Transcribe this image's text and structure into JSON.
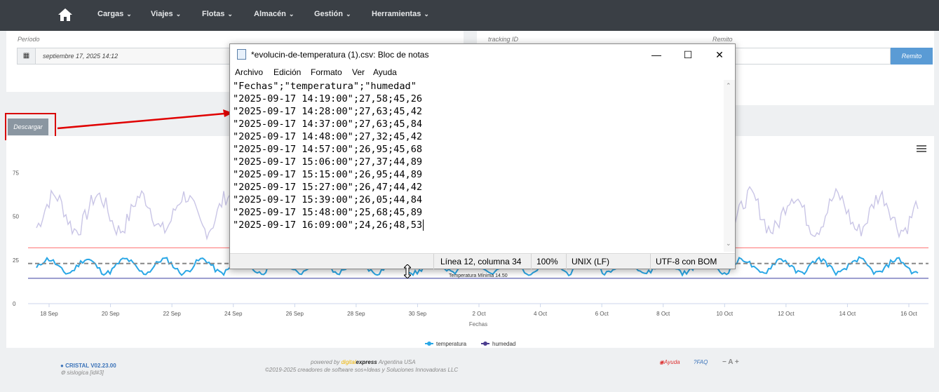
{
  "nav": {
    "items": [
      {
        "label": "Cargas"
      },
      {
        "label": "Viajes"
      },
      {
        "label": "Flotas"
      },
      {
        "label": "Almacén"
      },
      {
        "label": "Gestión"
      },
      {
        "label": "Herramientas"
      }
    ]
  },
  "filters": {
    "periodo_label": "Período",
    "periodo_value": "septiembre 17, 2025 14:12",
    "tracking_label": "tracking ID",
    "remito_label": "Remito",
    "remito_button": "Remito"
  },
  "download_button": "Descargar",
  "chart_data": {
    "type": "line",
    "xlabel": "Fechas",
    "ylabel": "",
    "ylim": [
      0,
      80
    ],
    "y_ticks": [
      "0",
      "25",
      "50",
      "75"
    ],
    "x_ticks": [
      "18 Sep",
      "20 Sep",
      "22 Sep",
      "24 Sep",
      "26 Sep",
      "28 Sep",
      "30 Sep",
      "2 Oct",
      "4 Oct",
      "6 Oct",
      "8 Oct",
      "10 Oct",
      "12 Oct",
      "14 Oct",
      "16 Oct"
    ],
    "series": [
      {
        "name": "temperatura",
        "color": "#2aa7e6"
      },
      {
        "name": "humedad",
        "color": "#4b3d8f"
      }
    ],
    "plot_lines": [
      {
        "label": "",
        "value": 32,
        "color": "#ff7070"
      },
      {
        "label": "",
        "value": 23,
        "color": "#888888",
        "dash": true
      },
      {
        "label": "Temperatura Mínima 14.50",
        "value": 14.5,
        "color": "#3a3f9f"
      }
    ],
    "legend": "bottom-center",
    "grid": false
  },
  "notepad": {
    "title": "*evolucin-de-temperatura (1).csv: Bloc de notas",
    "menu": [
      "Archivo",
      "Edición",
      "Formato",
      "Ver",
      "Ayuda"
    ],
    "lines": [
      "\"Fechas\";\"temperatura\";\"humedad\"",
      "\"2025-09-17 14:19:00\";27,58;45,26",
      "\"2025-09-17 14:28:00\";27,63;45,42",
      "\"2025-09-17 14:37:00\";27,63;45,84",
      "\"2025-09-17 14:48:00\";27,32;45,42",
      "\"2025-09-17 14:57:00\";26,95;45,68",
      "\"2025-09-17 15:06:00\";27,37;44,89",
      "\"2025-09-17 15:15:00\";26,95;44,89",
      "\"2025-09-17 15:27:00\";26,47;44,42",
      "\"2025-09-17 15:39:00\";26,05;44,84",
      "\"2025-09-17 15:48:00\";25,68;45,89",
      "\"2025-09-17 16:09:00\";24,26;48,53"
    ],
    "status": {
      "position": "Línea 12, columna 34",
      "zoom": "100%",
      "eol": "UNIX (LF)",
      "encoding": "UTF-8 con BOM"
    }
  },
  "footer": {
    "version": "CRISTAL V02.23.00",
    "user": "sislogica [id#3]",
    "powered_prefix": "powered by",
    "powered_brand1": "digital",
    "powered_brand2": "express",
    "powered_suffix": "Argentina USA",
    "copyright": "©2019-2025 creadores de software sos+Ideas y Soluciones Innovadoras LLC",
    "help": "Ayuda",
    "faq": "FAQ",
    "font_size_controls": "− A +"
  }
}
